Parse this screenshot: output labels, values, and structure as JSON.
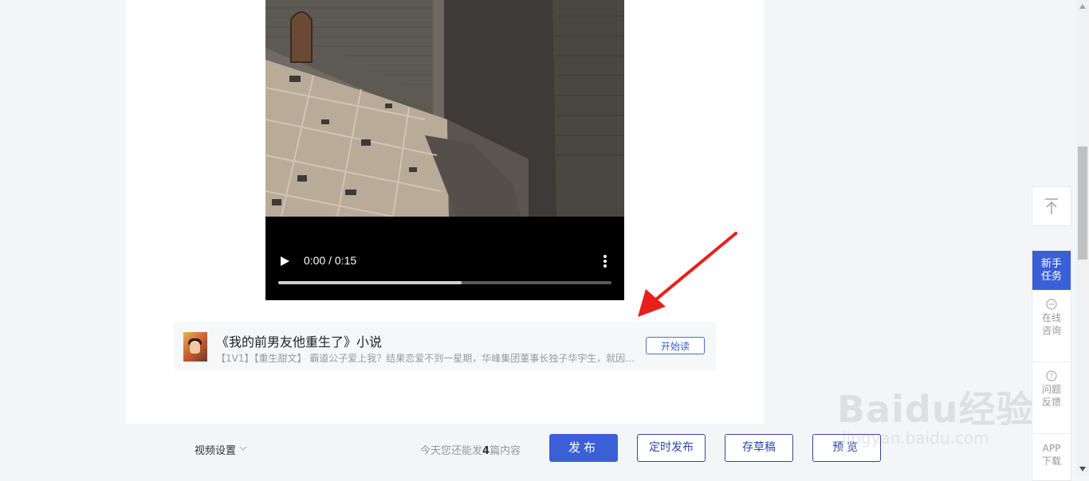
{
  "video": {
    "time": "0:00 / 0:15",
    "progress": 0.55
  },
  "novel": {
    "title": "《我的前男友他重生了》小说",
    "description": "【1V1】【重生甜文】 霸道公子爱上我？结果恋爱不到一星期，华峰集团董事长独子华宇生，就因…",
    "start_label": "开始读"
  },
  "bottom_bar": {
    "video_settings_label": "视频设置",
    "quota_prefix": "今天您还能发",
    "quota_count": "4",
    "quota_suffix": "篇内容",
    "publish_label": "发布",
    "schedule_label": "定时发布",
    "draft_label": "存草稿",
    "preview_label": "预览"
  },
  "side_panel": {
    "task_line1": "新手",
    "task_line2": "任务",
    "consult_line1": "在线",
    "consult_line2": "咨询",
    "feedback_line1": "问题",
    "feedback_line2": "反馈",
    "app_line1": "APP",
    "app_line2": "下载"
  },
  "watermark": {
    "logo": "Baidu经验",
    "url": "jingyan.baidu.com"
  },
  "colors": {
    "accent": "#3b5fd6",
    "annotation": "#e8201a"
  },
  "icons": {
    "play": "play-icon",
    "more": "more-vertical-icon",
    "back_top": "arrow-up-icon",
    "consult": "chat-bubble-icon",
    "feedback": "question-circle-icon",
    "chevron": "chevron-down-icon"
  }
}
